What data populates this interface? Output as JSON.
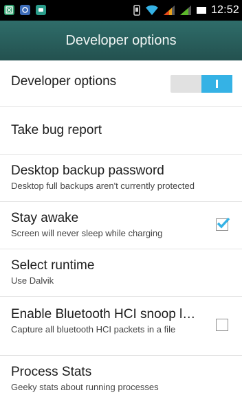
{
  "status_bar": {
    "time": "12:52",
    "icons": [
      "app-icon-1",
      "app-icon-2",
      "app-icon-3",
      "vibrate-icon",
      "wifi-icon",
      "signal-icon",
      "signal-icon",
      "battery-icon"
    ]
  },
  "action_bar": {
    "title": "Developer options"
  },
  "prefs": {
    "developer_options": {
      "title": "Developer options",
      "enabled": true
    },
    "bug_report": {
      "title": "Take bug report"
    },
    "backup_password": {
      "title": "Desktop backup password",
      "summary": "Desktop full backups aren't currently protected"
    },
    "stay_awake": {
      "title": "Stay awake",
      "summary": "Screen will never sleep while charging",
      "checked": true
    },
    "runtime": {
      "title": "Select runtime",
      "summary": "Use Dalvik"
    },
    "bt_snoop": {
      "title": "Enable Bluetooth HCI snoop l…",
      "summary": "Capture all bluetooth HCI packets in a file",
      "checked": false
    },
    "process_stats": {
      "title": "Process Stats",
      "summary": "Geeky stats about running processes"
    }
  },
  "colors": {
    "accent": "#35b2e5",
    "action_bar": "#2a5f5c"
  }
}
